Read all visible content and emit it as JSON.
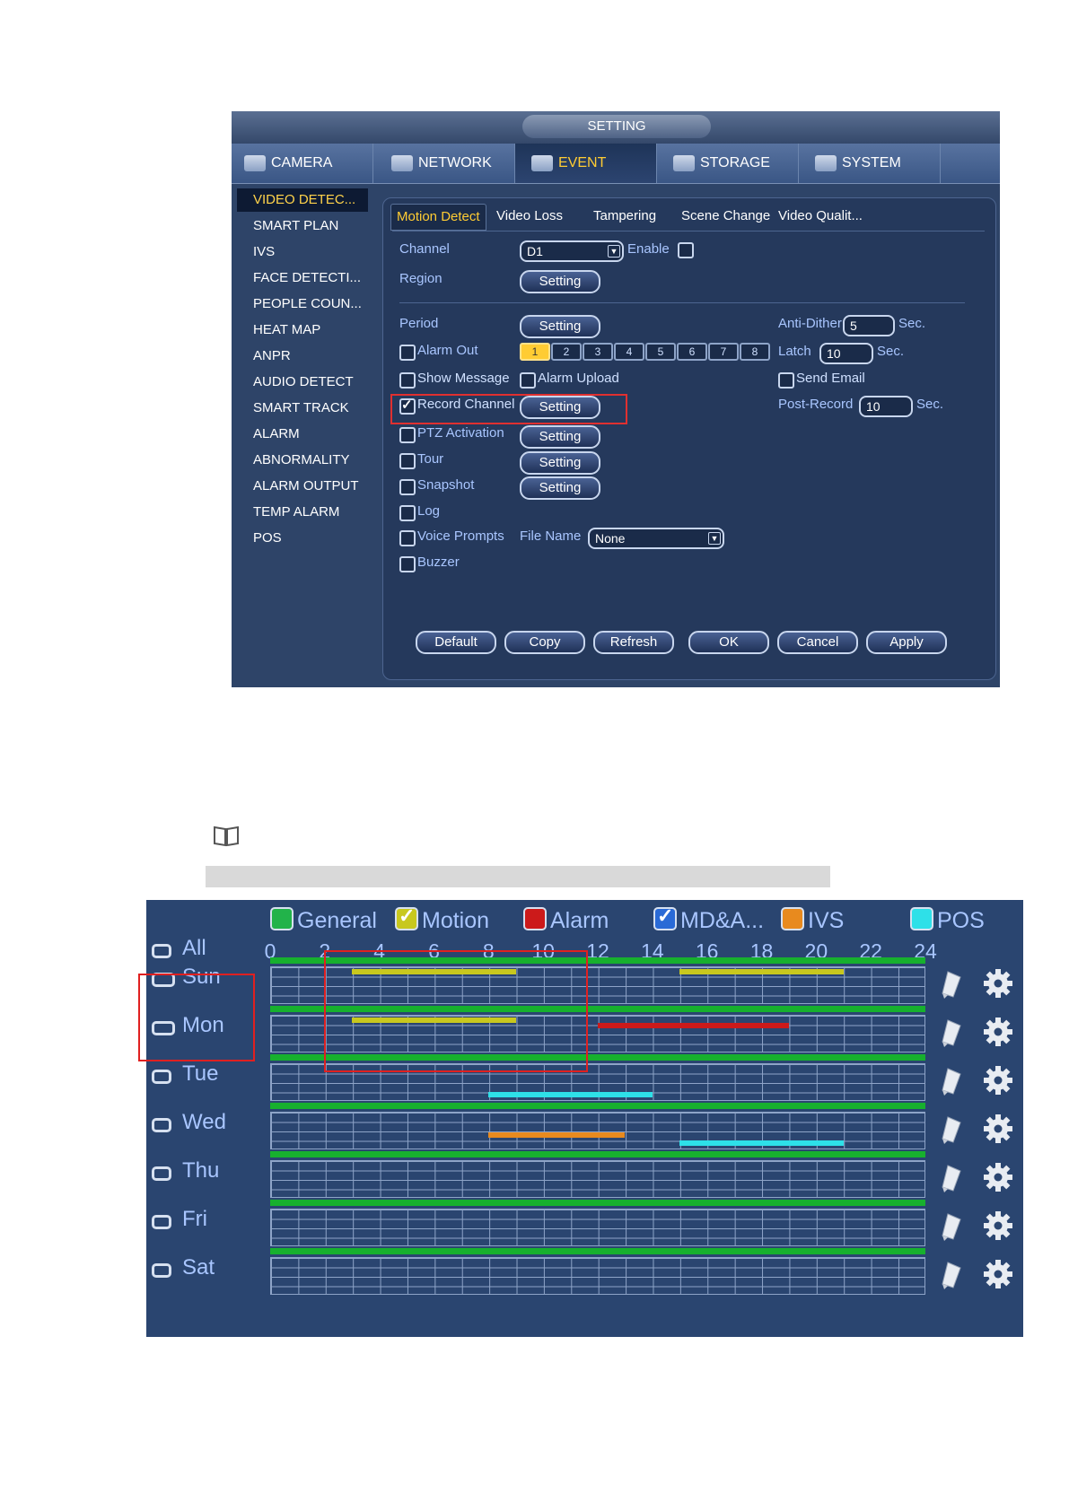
{
  "dvr": {
    "title": "SETTING",
    "main_tabs": [
      {
        "label": "CAMERA",
        "icon": "camera-icon"
      },
      {
        "label": "NETWORK",
        "icon": "network-icon"
      },
      {
        "label": "EVENT",
        "icon": "event-icon",
        "active": true
      },
      {
        "label": "STORAGE",
        "icon": "storage-icon"
      },
      {
        "label": "SYSTEM",
        "icon": "system-icon"
      }
    ],
    "sidebar": [
      {
        "label": "VIDEO DETEC...",
        "active": true
      },
      {
        "label": "SMART PLAN"
      },
      {
        "label": "IVS"
      },
      {
        "label": "FACE DETECTI..."
      },
      {
        "label": "PEOPLE COUN..."
      },
      {
        "label": "HEAT MAP"
      },
      {
        "label": "ANPR"
      },
      {
        "label": "AUDIO DETECT"
      },
      {
        "label": "SMART TRACK"
      },
      {
        "label": "ALARM"
      },
      {
        "label": "ABNORMALITY"
      },
      {
        "label": "ALARM OUTPUT"
      },
      {
        "label": "TEMP ALARM"
      },
      {
        "label": "POS"
      }
    ],
    "sub_tabs": [
      {
        "label": "Motion Detect",
        "active": true
      },
      {
        "label": "Video Loss"
      },
      {
        "label": "Tampering"
      },
      {
        "label": "Scene Change"
      },
      {
        "label": "Video Qualit..."
      }
    ],
    "form": {
      "channel_label": "Channel",
      "channel_value": "D1",
      "enable_label": "Enable",
      "region_label": "Region",
      "period_label": "Period",
      "setting_label": "Setting",
      "alarm_out_label": "Alarm Out",
      "alarm_out_channels": [
        "1",
        "2",
        "3",
        "4",
        "5",
        "6",
        "7",
        "8"
      ],
      "show_message_label": "Show Message",
      "alarm_upload_label": "Alarm Upload",
      "record_channel_label": "Record Channel",
      "ptz_label": "PTZ Activation",
      "tour_label": "Tour",
      "snapshot_label": "Snapshot",
      "log_label": "Log",
      "voice_label": "Voice Prompts",
      "file_name_label": "File Name",
      "file_name_value": "None",
      "buzzer_label": "Buzzer",
      "anti_dither_label": "Anti-Dither",
      "anti_dither_value": "5",
      "sec_label": "Sec.",
      "latch_label": "Latch",
      "latch_value": "10",
      "send_email_label": "Send Email",
      "post_record_label": "Post-Record",
      "post_record_value": "10"
    },
    "buttons": [
      "Default",
      "Copy",
      "Refresh",
      "OK",
      "Cancel",
      "Apply"
    ]
  },
  "schedule": {
    "legend": [
      {
        "label": "General",
        "color": "#22b34a",
        "checked": false
      },
      {
        "label": "Motion",
        "color": "#c8c81e",
        "checked": true
      },
      {
        "label": "Alarm",
        "color": "#cc1a1a",
        "checked": false
      },
      {
        "label": "MD&A...",
        "color": "#2a6ad6",
        "checked": true
      },
      {
        "label": "IVS",
        "color": "#e88a1e",
        "checked": false
      },
      {
        "label": "POS",
        "color": "#2ee0e8",
        "checked": false
      }
    ],
    "all_label": "All",
    "hours": [
      "0",
      "2",
      "4",
      "6",
      "8",
      "10",
      "12",
      "14",
      "16",
      "18",
      "20",
      "22",
      "24"
    ],
    "days": [
      {
        "label": "Sun",
        "linked": true,
        "segments": [
          {
            "type": "Motion",
            "start": 3,
            "end": 9
          },
          {
            "type": "Motion",
            "start": 15,
            "end": 21
          }
        ]
      },
      {
        "label": "Mon",
        "linked": true,
        "segments": [
          {
            "type": "Motion",
            "start": 3,
            "end": 9
          },
          {
            "type": "Alarm",
            "start": 12,
            "end": 19
          }
        ]
      },
      {
        "label": "Tue",
        "linked": false,
        "segments": [
          {
            "type": "POS",
            "start": 8,
            "end": 14
          }
        ]
      },
      {
        "label": "Wed",
        "linked": false,
        "segments": [
          {
            "type": "IVS",
            "start": 8,
            "end": 13
          },
          {
            "type": "POS",
            "start": 15,
            "end": 21
          }
        ]
      },
      {
        "label": "Thu",
        "linked": false,
        "segments": []
      },
      {
        "label": "Fri",
        "linked": false,
        "segments": []
      },
      {
        "label": "Sat",
        "linked": false,
        "segments": []
      }
    ]
  }
}
